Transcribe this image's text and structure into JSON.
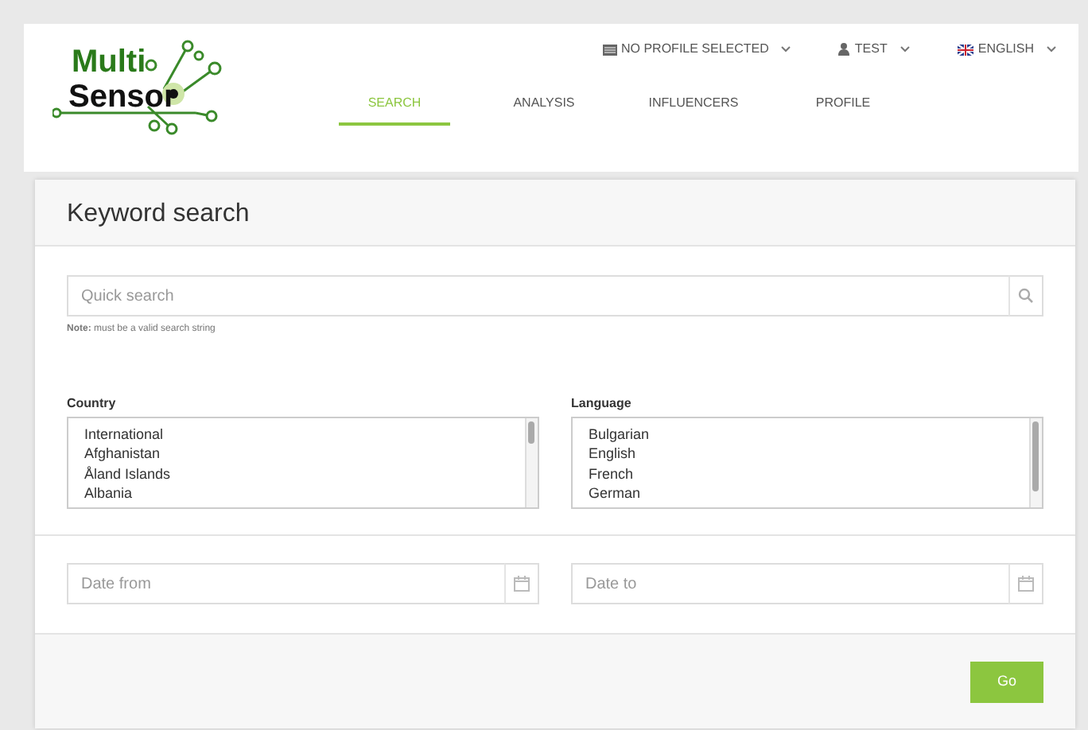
{
  "logo": {
    "line_1": "Multi",
    "line_2": "Sensor"
  },
  "top_menu": [
    {
      "kind": "profile",
      "label": "NO PROFILE SELECTED"
    },
    {
      "kind": "user",
      "label": "TEST"
    },
    {
      "kind": "language",
      "label": "ENGLISH"
    }
  ],
  "tabs": [
    {
      "label": "SEARCH",
      "selected": true
    },
    {
      "label": "ANALYSIS",
      "selected": false
    },
    {
      "label": "INFLUENCERS",
      "selected": false
    },
    {
      "label": "PROFILE",
      "selected": false
    }
  ],
  "panel": {
    "title": "Keyword search",
    "search": {
      "placeholder": "Quick search"
    },
    "note": "**Note:** must be a valid search string",
    "country": {
      "label": "Country",
      "options": [
        "International",
        "Afghanistan",
        "Åland Islands",
        "Albania"
      ]
    },
    "language": {
      "label": "Language",
      "options": [
        "Bulgarian",
        "English",
        "French",
        "German"
      ]
    },
    "date_from": {
      "placeholder": "Date from"
    },
    "date_to": {
      "placeholder": "Date to"
    },
    "button": "Go"
  }
}
